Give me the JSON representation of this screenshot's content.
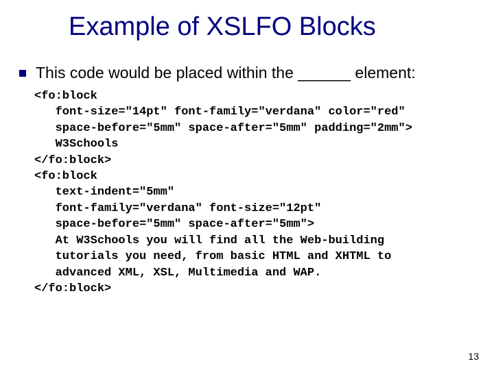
{
  "slide": {
    "title": "Example of XSLFO Blocks",
    "bullet": "This code would be placed within the ______ element:",
    "page_number": "13"
  },
  "code": {
    "l1": "<fo:block",
    "l2": "   font-size=\"14pt\" font-family=\"verdana\" color=\"red\"",
    "l3": "   space-before=\"5mm\" space-after=\"5mm\" padding=\"2mm\">",
    "l4": "   W3Schools",
    "l5": "</fo:block>",
    "l6": "<fo:block",
    "l7": "   text-indent=\"5mm\"",
    "l8": "   font-family=\"verdana\" font-size=\"12pt\"",
    "l9": "   space-before=\"5mm\" space-after=\"5mm\">",
    "l10": "   At W3Schools you will find all the Web-building",
    "l11": "   tutorials you need, from basic HTML and XHTML to",
    "l12": "   advanced XML, XSL, Multimedia and WAP.",
    "l13": "</fo:block>"
  }
}
